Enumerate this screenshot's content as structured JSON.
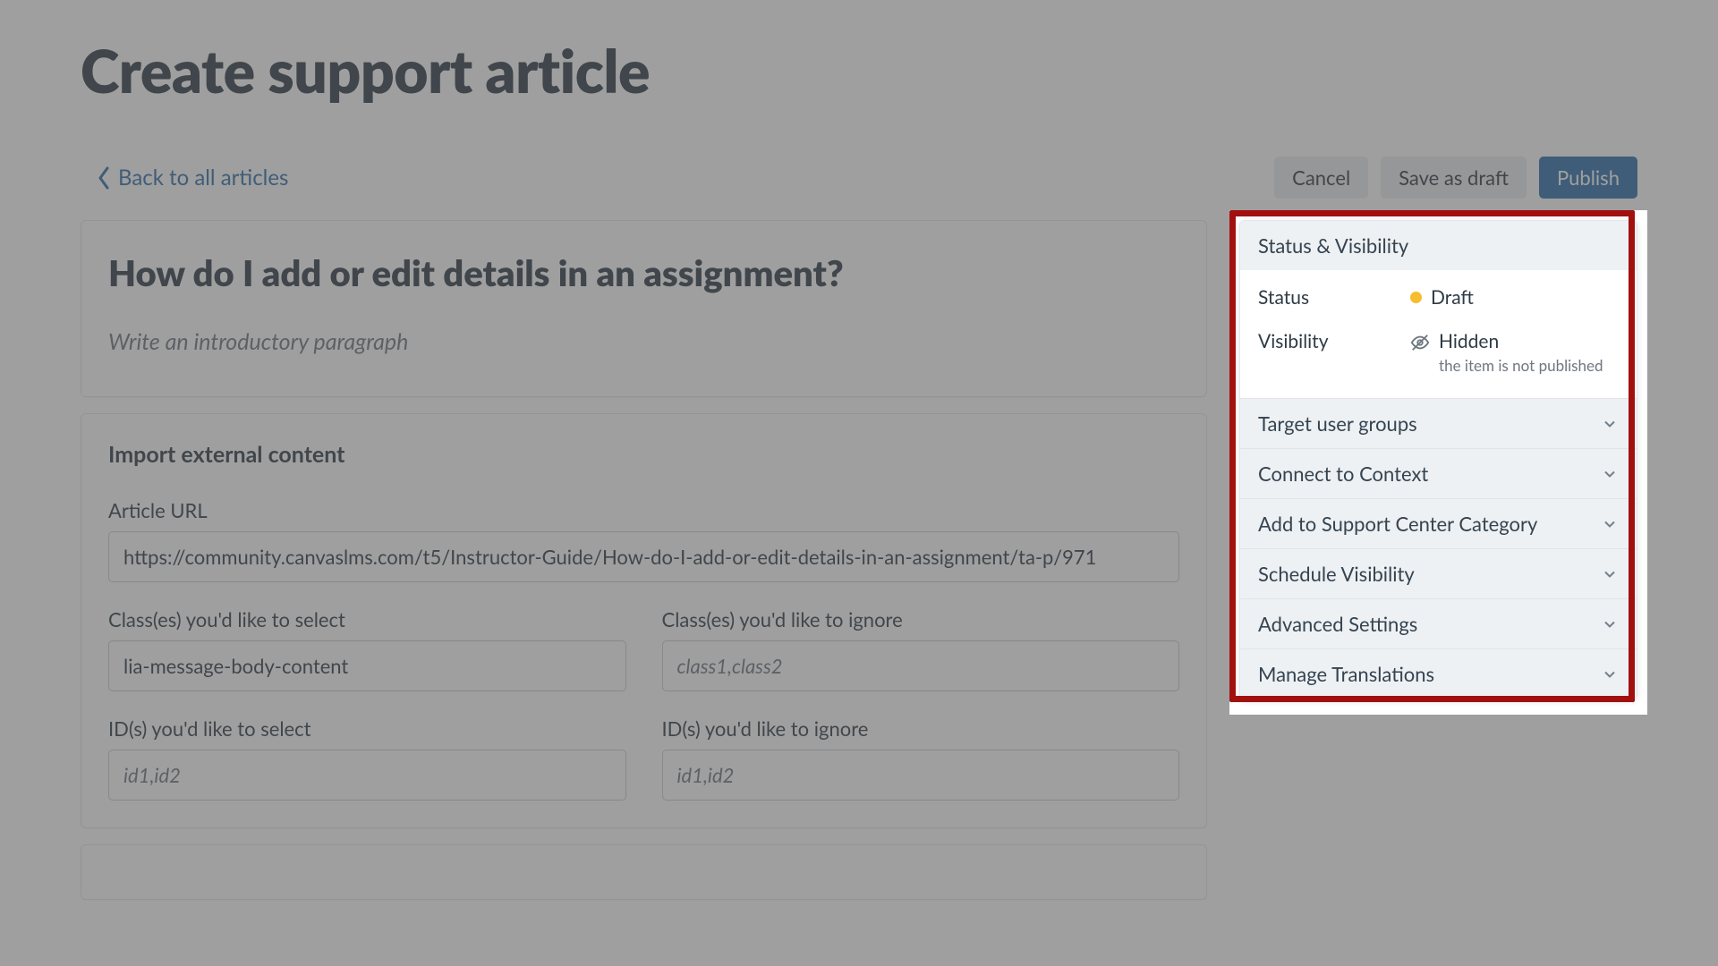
{
  "page": {
    "title": "Create support article"
  },
  "toolbar": {
    "back_label": "Back to all articles",
    "cancel_label": "Cancel",
    "save_draft_label": "Save as draft",
    "publish_label": "Publish"
  },
  "intro": {
    "article_heading": "How do I add or edit details in an assignment?",
    "intro_placeholder": "Write an introductory paragraph"
  },
  "import": {
    "section_title": "Import external content",
    "url_label": "Article URL",
    "url_value": "https://community.canvaslms.com/t5/Instructor-Guide/How-do-I-add-or-edit-details-in-an-assignment/ta-p/971",
    "classes_select_label": "Class(es) you'd like to select",
    "classes_select_value": "lia-message-body-content",
    "classes_ignore_label": "Class(es) you'd like to ignore",
    "classes_ignore_placeholder": "class1,class2",
    "ids_select_label": "ID(s) you'd like to select",
    "ids_select_placeholder": "id1,id2",
    "ids_ignore_label": "ID(s) you'd like to ignore",
    "ids_ignore_placeholder": "id1,id2"
  },
  "sidebar": {
    "status_header": "Status & Visibility",
    "status_label": "Status",
    "status_value": "Draft",
    "visibility_label": "Visibility",
    "visibility_value": "Hidden",
    "visibility_note": "the item is not published",
    "sections": [
      "Target user groups",
      "Connect to Context",
      "Add to Support Center Category",
      "Schedule Visibility",
      "Advanced Settings",
      "Manage Translations"
    ]
  }
}
